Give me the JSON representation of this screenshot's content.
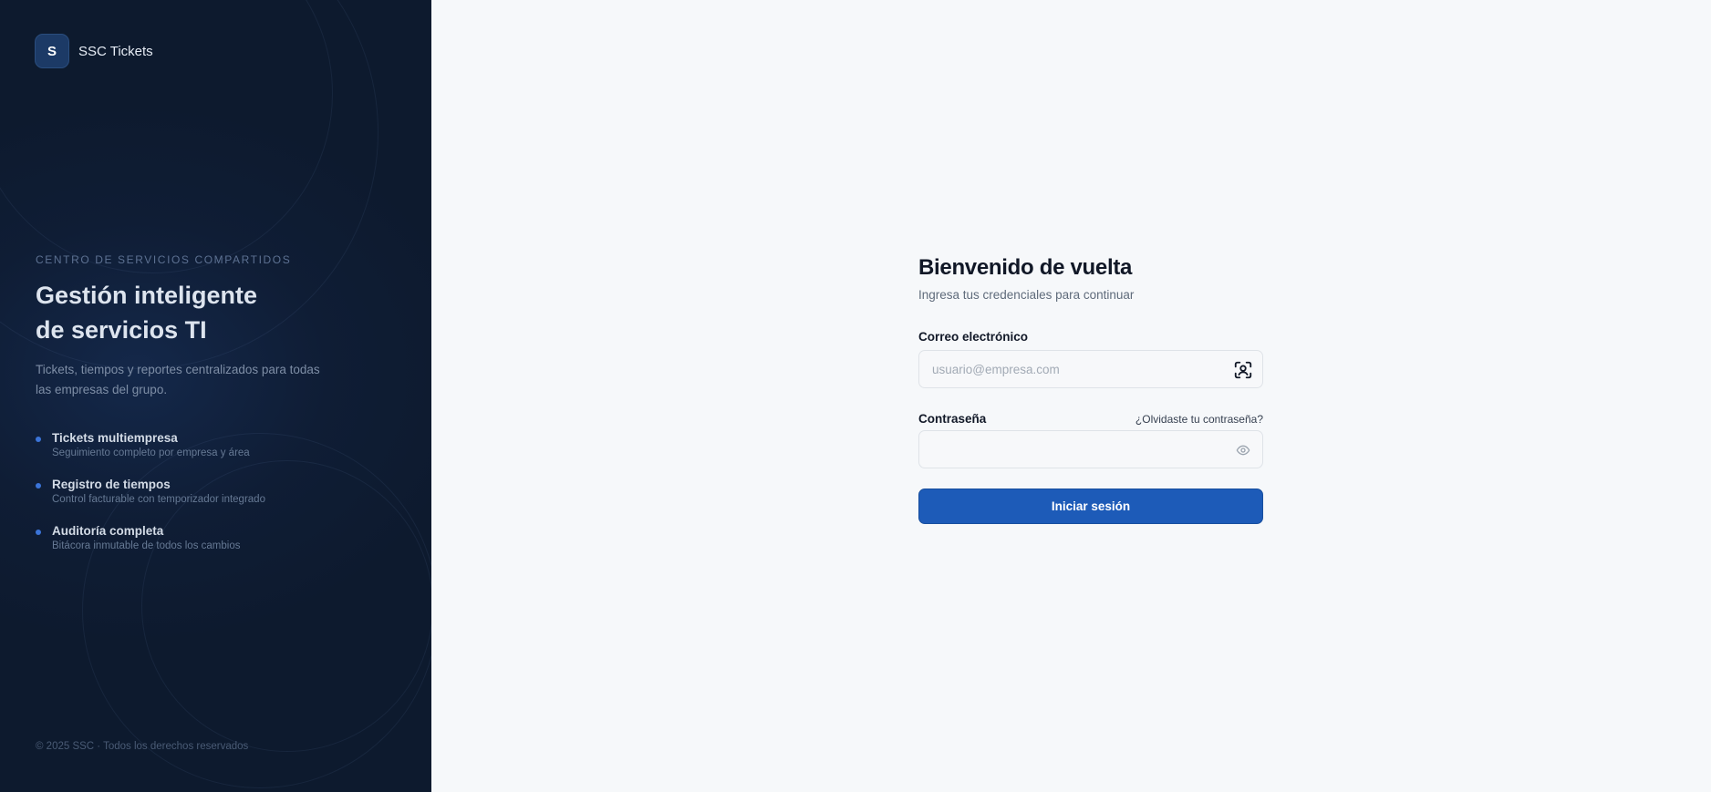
{
  "brand": {
    "initial": "S",
    "name": "SSC Tickets"
  },
  "hero": {
    "eyebrow": "CENTRO DE SERVICIOS COMPARTIDOS",
    "title_line1": "Gestión inteligente",
    "title_line2": "de servicios TI",
    "description": "Tickets, tiempos y reportes centralizados para todas las empresas del grupo."
  },
  "features": [
    {
      "title": "Tickets multiempresa",
      "subtitle": "Seguimiento completo por empresa y área"
    },
    {
      "title": "Registro de tiempos",
      "subtitle": "Control facturable con temporizador integrado"
    },
    {
      "title": "Auditoría completa",
      "subtitle": "Bitácora inmutable de todos los cambios"
    }
  ],
  "footer": {
    "copyright": "© 2025 SSC · Todos los derechos reservados"
  },
  "login": {
    "title": "Bienvenido de vuelta",
    "subtitle": "Ingresa tus credenciales para continuar",
    "email": {
      "label": "Correo electrónico",
      "placeholder": "usuario@empresa.com",
      "value": "",
      "icon": "user-scan-icon"
    },
    "password": {
      "label": "Contraseña",
      "forgot": "¿Olvidaste tu contraseña?",
      "value": "",
      "icon": "eye-icon"
    },
    "submit_label": "Iniciar sesión"
  },
  "colors": {
    "panel_bg": "#0f1d35",
    "accent": "#1d5bb8",
    "bullet": "#3b74d8",
    "page_bg": "#f6f8fa"
  }
}
